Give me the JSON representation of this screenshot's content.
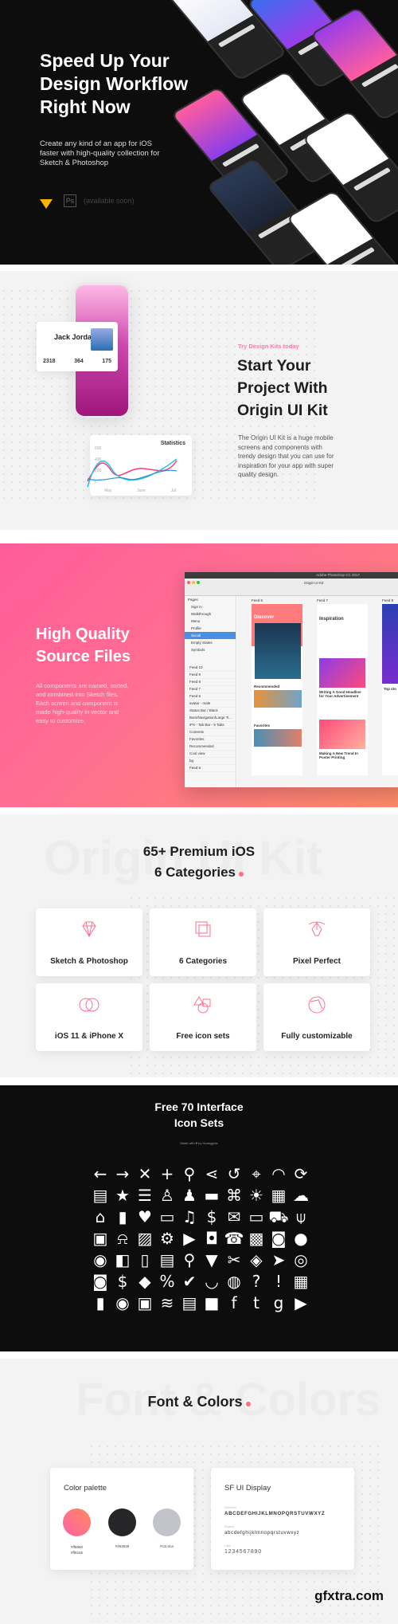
{
  "hero": {
    "title_lines": [
      "Speed Up Your",
      "Design Workflow",
      "Right Now"
    ],
    "subtitle_lines": [
      "Create any kind of an app for iOS",
      "faster with high-quality collection for",
      "Sketch & Photoshop"
    ],
    "ps_label": "Ps",
    "available_soon": "(available soon)"
  },
  "intro": {
    "eyebrow": "Try Design Kits today",
    "title_lines": [
      "Start Your",
      "Project With",
      "Origin UI Kit"
    ],
    "body_lines": [
      "The Origin UI Kit is a huge mobile",
      "screens and components with",
      "trendy design that you can use for",
      "inspiration for your app with super",
      "quality design."
    ],
    "profile": {
      "name": "Jack Jordan",
      "stats": [
        {
          "value": "2318"
        },
        {
          "value": "364"
        },
        {
          "value": "175"
        }
      ]
    },
    "stats_card": {
      "title": "Statistics",
      "y_ticks": [
        "600",
        "400",
        "200",
        "0"
      ],
      "x_ticks": [
        "May",
        "June",
        "Jul"
      ]
    }
  },
  "source": {
    "title_lines": [
      "High Quality",
      "Source Files"
    ],
    "body_lines": [
      "All components are named, sorted,",
      "and combined into Sketch files.",
      "Each screen and component is",
      "made high-quality in vector and",
      "easy to customize."
    ],
    "window": {
      "title": "Adobe Photoshop CC 2017",
      "doc": "Origin UI Kit",
      "pages_header": "Pages",
      "pages": [
        "Sign in",
        "Walkthrough",
        "Menu",
        "Profile",
        "Social",
        "Empty States",
        "Symbols"
      ],
      "selected_page": "Social",
      "layers": [
        "Feed 10",
        "Feed 9",
        "Feed 8",
        "Feed 7",
        "Feed 6",
        "avatar - male",
        "Status Bar / Black",
        "Bars/Navigation/Large Ti...",
        "iPX - Tab Bar - 5 Tabs",
        "Contents",
        "Favorites",
        "Recommended",
        "Cool view",
        "bg",
        "Feed 5"
      ],
      "artboards": [
        {
          "label": "Feed 6",
          "heading": "Discover",
          "sections": [
            "Recommended",
            "Favorites"
          ]
        },
        {
          "label": "Feed 7",
          "heading": "Inspiration",
          "sections": [
            "Writing A Good Headline for Your Advertisement",
            "Making A New Trend In Poster Printing"
          ]
        },
        {
          "label": "Feed 8",
          "heading": "Top sto"
        }
      ]
    }
  },
  "features": {
    "ghost": "Origin UI Kit",
    "title_lines": [
      "65+ Premium iOS",
      "6 Categories"
    ],
    "accent": "#ff6f7d",
    "items": [
      {
        "label": "Sketch & Photoshop",
        "icon": "diamond-icon"
      },
      {
        "label": "6 Categories",
        "icon": "layers-icon"
      },
      {
        "label": "Pixel Perfect",
        "icon": "pen-tool-icon"
      },
      {
        "label": "iOS 11 & iPhone X",
        "icon": "circles-icon"
      },
      {
        "label": "Free icon sets",
        "icon": "shapes-icon"
      },
      {
        "label": "Fully customizable",
        "icon": "palette-icon"
      }
    ]
  },
  "icons": {
    "title_lines": [
      "Free 70 Interface",
      "Icon Sets"
    ],
    "credit": "Made with ♥ by Hoanggnix",
    "set": [
      "arrow-left",
      "arrow-right",
      "close",
      "plus",
      "search",
      "share",
      "history",
      "crosshair",
      "speedometer",
      "refresh",
      "document",
      "star",
      "filter",
      "add-user",
      "users",
      "credit-card",
      "gift",
      "sun",
      "wallet-cards",
      "cloud",
      "home",
      "bar-chart",
      "heart",
      "chat",
      "music",
      "money-bag",
      "mail",
      "bed",
      "cart",
      "microphone",
      "browser",
      "bell",
      "image",
      "gear",
      "play",
      "shopping-bag",
      "phone",
      "qr-code",
      "android",
      "apple",
      "eye",
      "wallet",
      "book",
      "receipt",
      "location-pin",
      "trash",
      "tools",
      "compass",
      "navigation",
      "fingerprint",
      "camera",
      "dollar-badge",
      "tag",
      "coupon",
      "verified-badge",
      "wifi",
      "globe",
      "question",
      "exclamation",
      "grid",
      "bookmark",
      "map-marker",
      "lock",
      "layers",
      "bill",
      "video-camera",
      "facebook",
      "twitter",
      "google-plus",
      "youtube"
    ]
  },
  "fonts": {
    "ghost": "Font & Colors",
    "title": "Font & Colors",
    "palette_title": "Color palette",
    "colors": [
      {
        "hex": "#ff8960",
        "hex2": "#ff62a5"
      },
      {
        "hex": "#262628"
      },
      {
        "hex": "#c2c4ca"
      }
    ],
    "font_title": "SF UI Display",
    "weights": [
      {
        "name": "Semibold",
        "sample": "ABCDEFGHIJKLMNOPQRSTUVWXYZ"
      },
      {
        "name": "Regular",
        "sample": "abcdefghijklmnopqrstuvwxyz"
      },
      {
        "name": "Light",
        "sample": "1234567890"
      }
    ]
  },
  "watermark": "gfxtra.com"
}
